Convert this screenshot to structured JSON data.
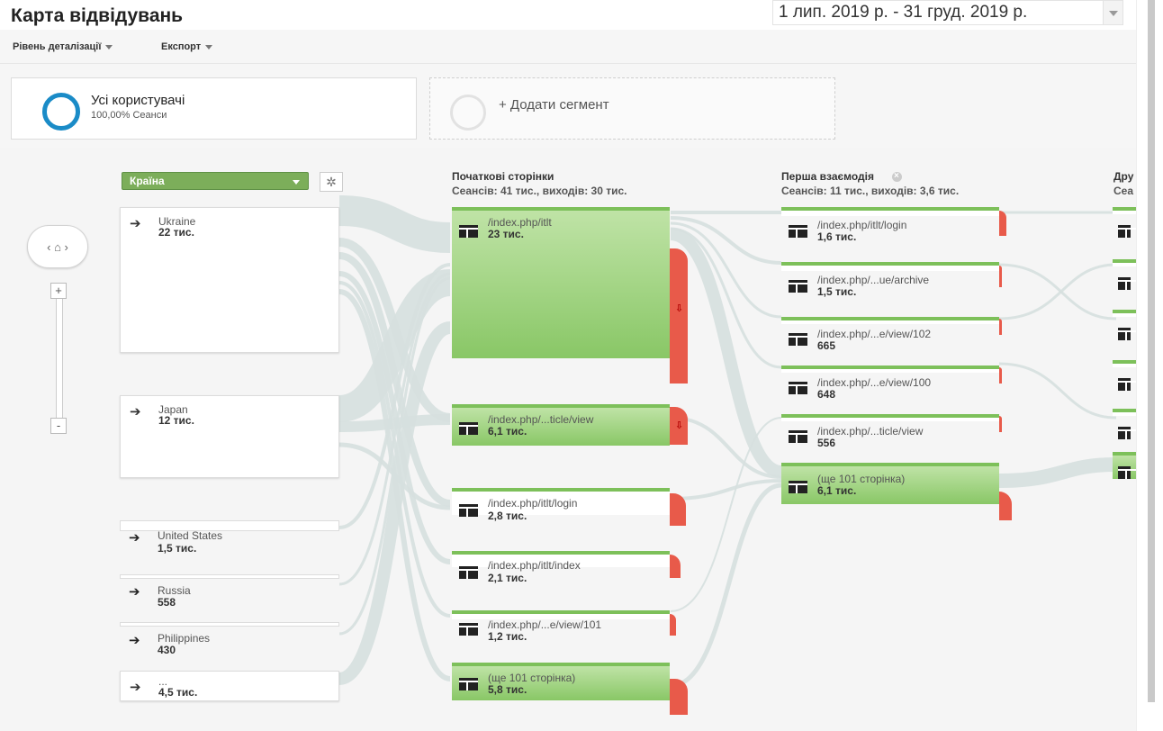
{
  "header": {
    "title": "Карта відвідувань",
    "date_range": "1 лип. 2019 р. - 31 груд. 2019 р."
  },
  "toolbar": {
    "detail_level": "Рівень деталізації",
    "export": "Експорт"
  },
  "segments": {
    "all_users_title": "Усі користувачі",
    "all_users_sub": "100,00% Сеанси",
    "add_segment": "+ Додати сегмент"
  },
  "colors": {
    "segment_ring": "#1a8bc7",
    "node_green": "#89c766",
    "exit_red": "#e85a4a",
    "dimension_select": "#7cae5a"
  },
  "controls": {
    "home": "‹ ⌂ ›",
    "zoom_in": "+",
    "zoom_out": "-",
    "gear": "✲"
  },
  "dimension": {
    "label": "Країна"
  },
  "columns": {
    "starting": {
      "title": "Початкові сторінки",
      "sub": "Сеансів: 41 тис., виходів: 30 тис."
    },
    "first": {
      "title": "Перша взаємодія",
      "sub": "Сеансів: 11 тис., виходів: 3,6 тис."
    },
    "second": {
      "title": "Дру",
      "sub": "Сеа"
    }
  },
  "countries": [
    {
      "name": "Ukraine",
      "count": "22 тис."
    },
    {
      "name": "Japan",
      "count": "12 тис."
    },
    {
      "name": "United States",
      "count": "1,5 тис."
    },
    {
      "name": "Russia",
      "count": "558"
    },
    {
      "name": "Philippines",
      "count": "430"
    },
    {
      "name": "...",
      "count": "4,5 тис."
    }
  ],
  "starting_pages": [
    {
      "url": "/index.php/itlt",
      "count": "23 тис."
    },
    {
      "url": "/index.php/...ticle/view",
      "count": "6,1 тис."
    },
    {
      "url": "/index.php/itlt/login",
      "count": "2,8 тис."
    },
    {
      "url": "/index.php/itlt/index",
      "count": "2,1 тис."
    },
    {
      "url": "/index.php/...e/view/101",
      "count": "1,2 тис."
    },
    {
      "url": "(ще 101 сторінка)",
      "count": "5,8 тис."
    }
  ],
  "first_interaction": [
    {
      "url": "/index.php/itlt/login",
      "count": "1,6 тис."
    },
    {
      "url": "/index.php/...ue/archive",
      "count": "1,5 тис."
    },
    {
      "url": "/index.php/...e/view/102",
      "count": "665"
    },
    {
      "url": "/index.php/...e/view/100",
      "count": "648"
    },
    {
      "url": "/index.php/...ticle/view",
      "count": "556"
    },
    {
      "url": "(ще 101 сторінка)",
      "count": "6,1 тис."
    }
  ],
  "exit_marker": "⇩"
}
